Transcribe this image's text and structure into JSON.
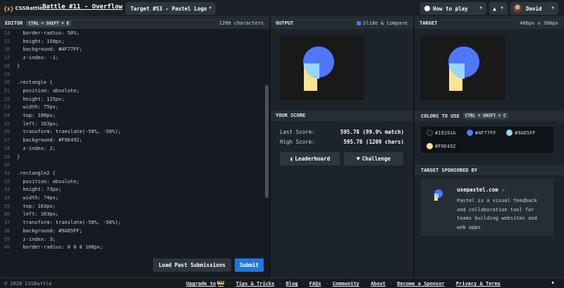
{
  "header": {
    "logo_mark": "{x}",
    "logo_text": "CSSBattle",
    "separator": "/",
    "battle_title": "Battle #11 - Overflow",
    "target_select": "Target #53 - Pastel Logo",
    "how_to_play": "How to play",
    "user_name": "David"
  },
  "editor": {
    "title": "EDITOR",
    "shortcut": "CTRL + SHIFT + E",
    "char_count": "1209 characters",
    "lines": [
      {
        "n": "14",
        "text": "  border-radius: 50%;"
      },
      {
        "n": "15",
        "text": "  height: 150px;"
      },
      {
        "n": "16",
        "text": "  background: #4F77FF;"
      },
      {
        "n": "17",
        "text": "  z-index: -1;"
      },
      {
        "n": "18",
        "text": "}"
      },
      {
        "n": "19",
        "text": ""
      },
      {
        "n": "20",
        "text": ".rectangle {"
      },
      {
        "n": "21",
        "text": "  position: absolute;"
      },
      {
        "n": "22",
        "text": "  height: 125px;"
      },
      {
        "n": "23",
        "text": "  width: 75px;"
      },
      {
        "n": "24",
        "text": "  top: 188px;"
      },
      {
        "n": "25",
        "text": "  left: 163px;"
      },
      {
        "n": "26",
        "text": "  transform: translate(-50%, -50%);"
      },
      {
        "n": "27",
        "text": "  background: #F9E492;"
      },
      {
        "n": "28",
        "text": "  z-index: 2;"
      },
      {
        "n": "29",
        "text": "}"
      },
      {
        "n": "30",
        "text": ""
      },
      {
        "n": "31",
        "text": ".rectangle2 {"
      },
      {
        "n": "32",
        "text": "  position: absolute;"
      },
      {
        "n": "33",
        "text": "  height: 73px;"
      },
      {
        "n": "34",
        "text": "  width: 74px;"
      },
      {
        "n": "35",
        "text": "  top: 163px;"
      },
      {
        "n": "36",
        "text": "  left: 163px;"
      },
      {
        "n": "37",
        "text": "  transform: translate(-50%, -50%);"
      },
      {
        "n": "38",
        "text": "  background: #9AD5FF;"
      },
      {
        "n": "39",
        "text": "  z-index: 3;"
      },
      {
        "n": "40",
        "text": "  border-radius: 0 0 0 100px;"
      }
    ],
    "load_button": "Load Past Submissions",
    "submit_button": "Submit"
  },
  "output": {
    "title": "OUTPUT",
    "slide_compare": "Slide & Compare",
    "your_score_title": "YOUR SCORE",
    "last_score_label": "Last Score:",
    "last_score_value": "595.78 (99.9% match)",
    "high_score_label": "High Score:",
    "high_score_value": "595.78 (1209 chars)",
    "leaderboard_button": "Leaderboard",
    "challenge_button": "Challenge"
  },
  "target": {
    "title": "TARGET",
    "size": "400px x 300px",
    "colors_title": "COLORS TO USE",
    "colors_shortcut": "CTRL + SHIFT + C",
    "colors": [
      {
        "hex": "#19191A",
        "label": "#19191A"
      },
      {
        "hex": "#4F77FF",
        "label": "#4F77FF"
      },
      {
        "hex": "#9AD5FF",
        "label": "#9AD5FF"
      },
      {
        "hex": "#F9E492",
        "label": "#F9E492"
      }
    ],
    "sponsor_title": "TARGET SPONSORED BY",
    "sponsor_name": "usepastel.com",
    "sponsor_desc": "Pastel is a visual feedback and collaboration tool for teams building websites and web apps"
  },
  "footer": {
    "copyright": "© 2020 CSSBattle",
    "links": [
      "Upgrade to",
      "Tips & Tricks",
      "Blog",
      "FAQs",
      "Community",
      "About",
      "Become a Sponsor",
      "Privacy & Terms"
    ],
    "new_badge": "PRO"
  },
  "icons": [
    "chevron-down-icon",
    "bell-icon",
    "leaderboard-icon",
    "heart-icon",
    "external-link-icon",
    "twitter-icon"
  ]
}
